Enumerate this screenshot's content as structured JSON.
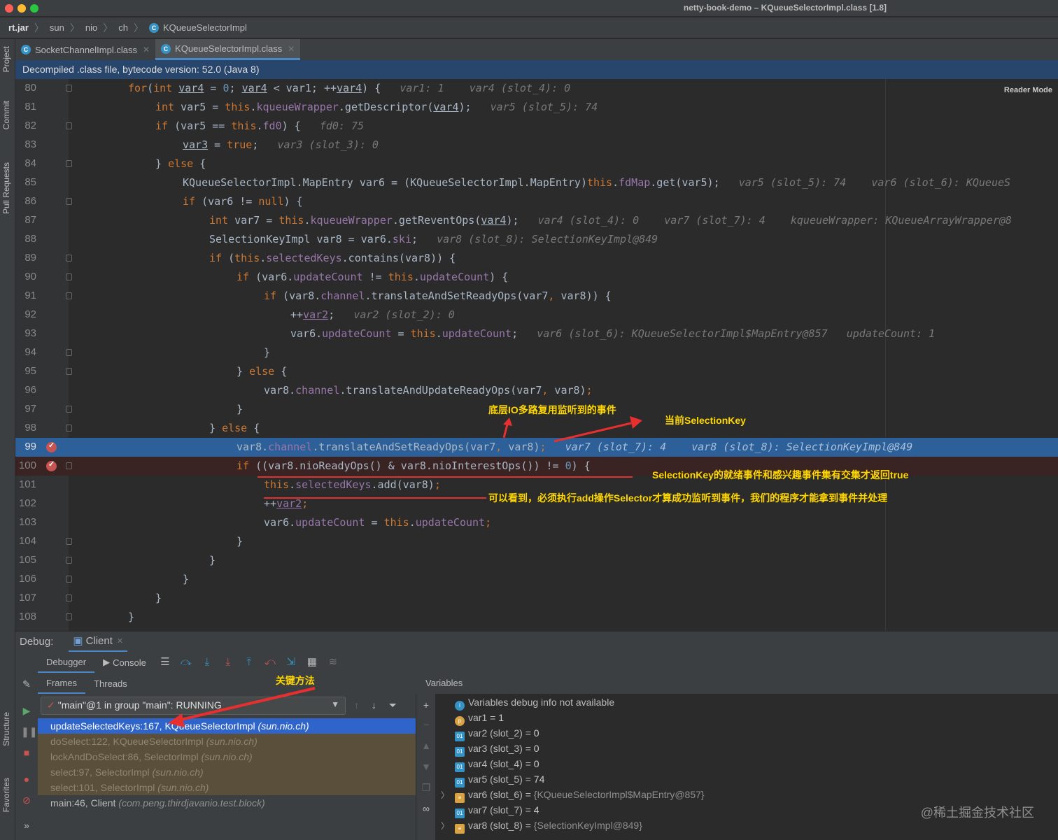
{
  "window": {
    "title": "netty-book-demo – KQueueSelectorImpl.class [1.8]"
  },
  "breadcrumb": [
    "rt.jar",
    "sun",
    "nio",
    "ch",
    "KQueueSelectorImpl"
  ],
  "left_strip": [
    "Project",
    "Commit",
    "Pull Requests",
    "Structure",
    "Favorites"
  ],
  "tabs": [
    {
      "label": "SocketChannelImpl.class",
      "active": false
    },
    {
      "label": "KQueueSelectorImpl.class",
      "active": true
    }
  ],
  "banner": "Decompiled .class file, bytecode version: 52.0 (Java 8)",
  "reader_mode": "Reader Mode",
  "line_numbers": [
    "80",
    "81",
    "82",
    "83",
    "84",
    "85",
    "86",
    "87",
    "88",
    "89",
    "90",
    "91",
    "92",
    "93",
    "94",
    "95",
    "96",
    "97",
    "98",
    "99",
    "100",
    "101",
    "102",
    "103",
    "104",
    "105",
    "106",
    "107",
    "108"
  ],
  "hints": {
    "l80a": "var1: 1",
    "l80b": "var4 (slot_4): 0",
    "l81": "var5 (slot_5): 74",
    "l82": "fd0: 75",
    "l83": "var3 (slot_3): 0",
    "l85a": "var5 (slot_5): 74",
    "l85b": "var6 (slot_6): KQueueS",
    "l87a": "var4 (slot_4): 0",
    "l87b": "var7 (slot_7): 4",
    "l87c": "kqueueWrapper: KQueueArrayWrapper@8",
    "l88": "var8 (slot_8): SelectionKeyImpl@849",
    "l92": "var2 (slot_2): 0",
    "l93a": "var6 (slot_6): KQueueSelectorImpl$MapEntry@857",
    "l93b": "updateCount: 1",
    "l99a": "var7 (slot_7): 4",
    "l99b": "var8 (slot_8): SelectionKeyImpl@849"
  },
  "annotations": {
    "underlying_events": "底层IO多路复用监听到的事件",
    "current_key": "当前SelectionKey",
    "intersection": "SelectionKey的就绪事件和感兴趣事件集有交集才返回true",
    "add_note": "可以看到，必须执行add操作Selector才算成功监听到事件，我们的程序才能拿到事件并处理",
    "key_method": "关键方法"
  },
  "debug": {
    "label": "Debug:",
    "config": "Client",
    "tabs": [
      "Debugger",
      "Console"
    ],
    "frame_tabs": [
      "Frames",
      "Threads"
    ],
    "thread": "\"main\"@1 in group \"main\": RUNNING",
    "frames": [
      {
        "method": "updateSelectedKeys:167, KQueueSelectorImpl",
        "pkg": "(sun.nio.ch)",
        "kind": "selected"
      },
      {
        "method": "doSelect:122, KQueueSelectorImpl",
        "pkg": "(sun.nio.ch)",
        "kind": "lib"
      },
      {
        "method": "lockAndDoSelect:86, SelectorImpl",
        "pkg": "(sun.nio.ch)",
        "kind": "lib"
      },
      {
        "method": "select:97, SelectorImpl",
        "pkg": "(sun.nio.ch)",
        "kind": "lib"
      },
      {
        "method": "select:101, SelectorImpl",
        "pkg": "(sun.nio.ch)",
        "kind": "lib"
      },
      {
        "method": "main:46, Client",
        "pkg": "(com.peng.thirdjavanio.test.block)",
        "kind": "user"
      }
    ],
    "variables_title": "Variables",
    "variables": [
      {
        "name": "Variables debug info not available",
        "value": "",
        "icon": "info"
      },
      {
        "name": "var1",
        "value": "1",
        "icon": "p"
      },
      {
        "name": "var2 (slot_2)",
        "value": "0",
        "icon": "prim"
      },
      {
        "name": "var3 (slot_3)",
        "value": "0",
        "icon": "prim"
      },
      {
        "name": "var4 (slot_4)",
        "value": "0",
        "icon": "prim"
      },
      {
        "name": "var5 (slot_5)",
        "value": "74",
        "icon": "prim"
      },
      {
        "name": "var6 (slot_6)",
        "value": "{KQueueSelectorImpl$MapEntry@857}",
        "icon": "obj"
      },
      {
        "name": "var7 (slot_7)",
        "value": "4",
        "icon": "prim"
      },
      {
        "name": "var8 (slot_8)",
        "value": "{SelectionKeyImpl@849}",
        "icon": "obj"
      }
    ]
  },
  "watermark": "@稀土掘金技术社区",
  "colors": {
    "highlight": "#2d6099",
    "breakpoint": "#c75450",
    "annotation": "#ffd700",
    "arrow": "#e63030"
  }
}
